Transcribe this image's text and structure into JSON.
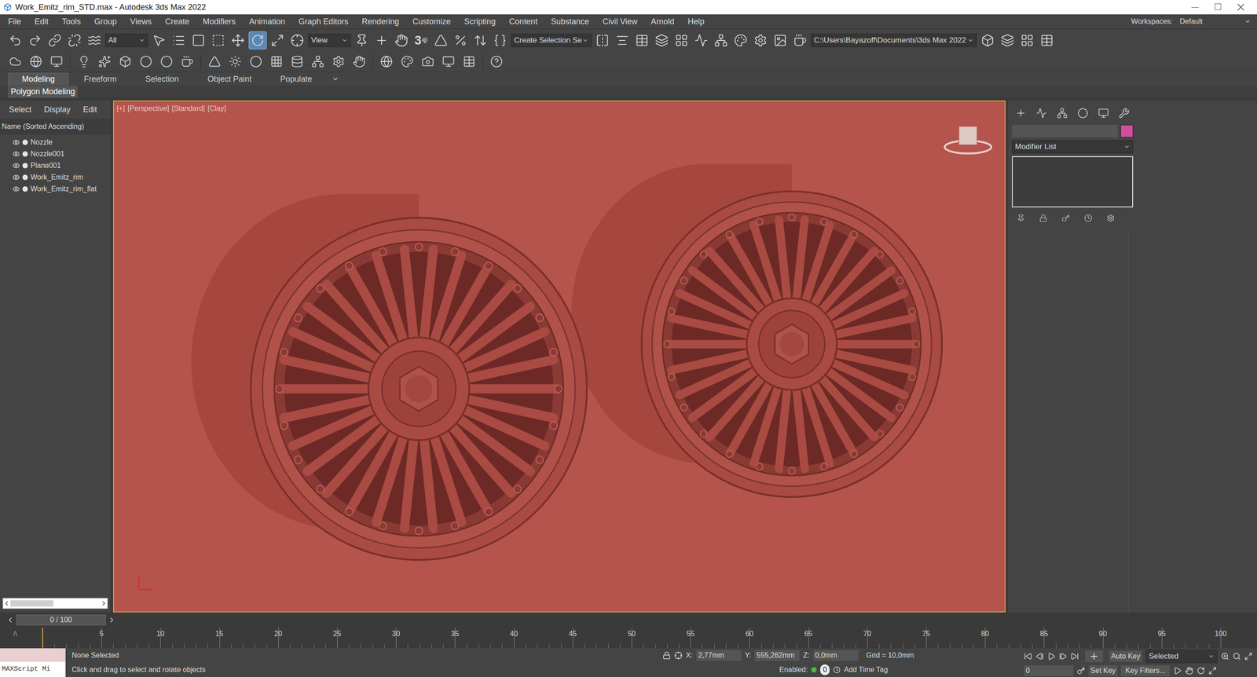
{
  "window": {
    "title": "Work_Emitz_rim_STD.max - Autodesk 3ds Max 2022"
  },
  "menu": [
    "File",
    "Edit",
    "Tools",
    "Group",
    "Views",
    "Create",
    "Modifiers",
    "Animation",
    "Graph Editors",
    "Rendering",
    "Customize",
    "Scripting",
    "Content",
    "Substance",
    "Civil View",
    "Arnold",
    "Help"
  ],
  "workspaces": {
    "label": "Workspaces:",
    "value": "Default"
  },
  "toolbar": {
    "selection_filter": "All",
    "reference_coord": "View",
    "snaps": "3",
    "named_selection": "Create Selection Se",
    "project_path": "C:\\Users\\Bayazoff\\Documents\\3ds Max 2022"
  },
  "ribbon": {
    "tabs": [
      {
        "label": "Modeling",
        "selected": true
      },
      {
        "label": "Freeform",
        "selected": false
      },
      {
        "label": "Selection",
        "selected": false
      },
      {
        "label": "Object Paint",
        "selected": false
      },
      {
        "label": "Populate",
        "selected": false
      }
    ],
    "panel": "Polygon Modeling"
  },
  "scene_explorer": {
    "tabs": [
      "Select",
      "Display",
      "Edit"
    ],
    "header": "Name (Sorted Ascending)",
    "items": [
      {
        "name": "Nozzle",
        "visible": true
      },
      {
        "name": "Nozzle001",
        "visible": true
      },
      {
        "name": "Plane001",
        "visible": true
      },
      {
        "name": "Work_Emitz_rim",
        "visible": true
      },
      {
        "name": "Work_Emitz_rim_flat",
        "visible": true
      }
    ]
  },
  "viewport": {
    "labels": [
      "[+]",
      "[Perspective]",
      "[Standard]",
      "[Clay]"
    ],
    "active": true
  },
  "command_panel": {
    "modifier_list": "Modifier List"
  },
  "timeline": {
    "slider": "0 / 100",
    "position": 0,
    "ticks": [
      "5",
      "10",
      "15",
      "20",
      "25",
      "30",
      "35",
      "40",
      "45",
      "50",
      "55",
      "60",
      "65",
      "70",
      "75",
      "80",
      "85",
      "90",
      "95",
      "100"
    ]
  },
  "status": {
    "maxscript": "MAXScript Mi",
    "selection": "None Selected",
    "prompt": "Click and drag to select and rotate objects",
    "x_label": "X:",
    "x": "2,77mm",
    "y_label": "Y:",
    "y": "555,262mm",
    "z_label": "Z:",
    "z": "0,0mm",
    "grid": "Grid = 10,0mm",
    "enabled": "Enabled:",
    "enabled_count": "0",
    "add_time_tag": "Add Time Tag",
    "auto_key": "Auto Key",
    "key_mode": "Selected",
    "set_key": "Set Key",
    "key_filters": "Key Filters...",
    "frame": "0"
  }
}
